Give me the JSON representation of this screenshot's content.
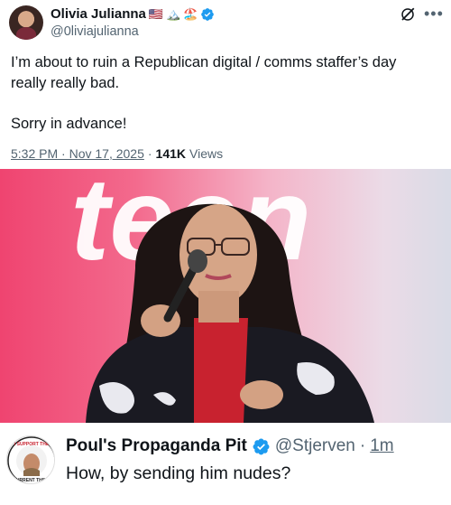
{
  "author": {
    "display_name": "Olivia Julianna",
    "emojis": [
      "🇺🇸",
      "🏔️",
      "🏖️"
    ],
    "handle": "@0liviajulianna",
    "verified": true
  },
  "tweet": {
    "text": "I’m about to ruin a Republican digital / comms staffer’s day\nreally really bad.\n\nSorry in advance!",
    "timestamp": "5:32 PM · Nov 17, 2025",
    "separator": "·",
    "views_count": "141K",
    "views_label": "Views"
  },
  "media": {
    "backdrop_text": "teen"
  },
  "reply": {
    "display_name": "Poul's Propaganda Pit",
    "handle": "@Stjerven",
    "separator": "·",
    "time": "1m",
    "text": "How, by sending him nudes?",
    "verified": true,
    "avatar_text_top": "I SUPPORT THE",
    "avatar_text_bottom": "CURRENT THING"
  },
  "icons": {
    "verified": "verified-badge-icon",
    "grok": "grok-icon",
    "more": "more-icon"
  },
  "colors": {
    "verified": "#1d9bf0",
    "secondary_text": "#536471",
    "primary_text": "#0f1419"
  }
}
